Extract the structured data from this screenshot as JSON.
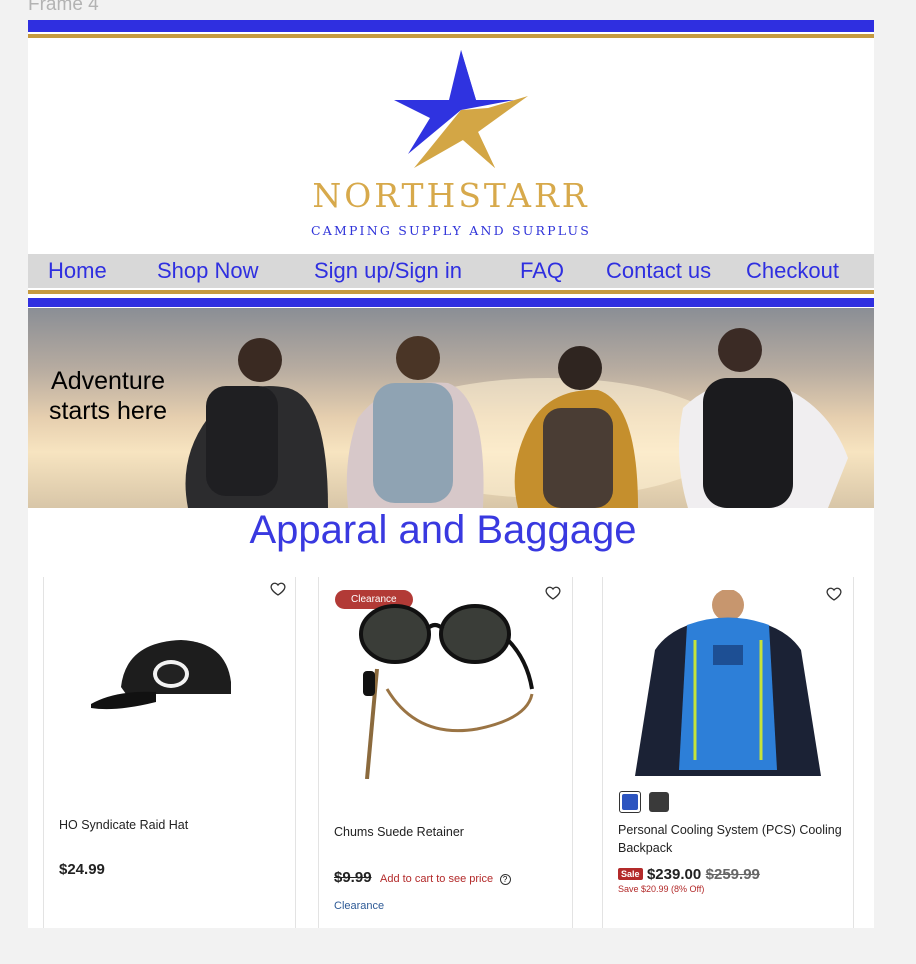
{
  "frame_label": "Frame 4",
  "brand": {
    "name": "NORTHSTARR",
    "tagline": "CAMPING SUPPLY AND SURPLUS",
    "colors": {
      "blue": "#2f2fe0",
      "gold": "#c59a3f"
    }
  },
  "nav": [
    {
      "label": "Home"
    },
    {
      "label": "Shop Now"
    },
    {
      "label": "Sign up/Sign in"
    },
    {
      "label": "FAQ"
    },
    {
      "label": "Contact us"
    },
    {
      "label": "Checkout"
    }
  ],
  "hero": {
    "text": "Adventure starts here"
  },
  "section_title": "Apparal and Baggage",
  "products": [
    {
      "name": "HO Syndicate Raid Hat",
      "price": "$24.99"
    },
    {
      "badge": "Clearance",
      "name": "Chums Suede Retainer",
      "price": "$9.99",
      "cart_note": "Add to cart to see price",
      "tag_link": "Clearance"
    },
    {
      "name": "Personal Cooling System (PCS) Cooling Backpack",
      "sale_badge": "Sale",
      "price": "$239.00",
      "original_price": "$259.99",
      "savings": "Save $20.99 (8% Off)",
      "swatch_colors": [
        "#2d55c0",
        "#3a3a3a"
      ]
    }
  ]
}
